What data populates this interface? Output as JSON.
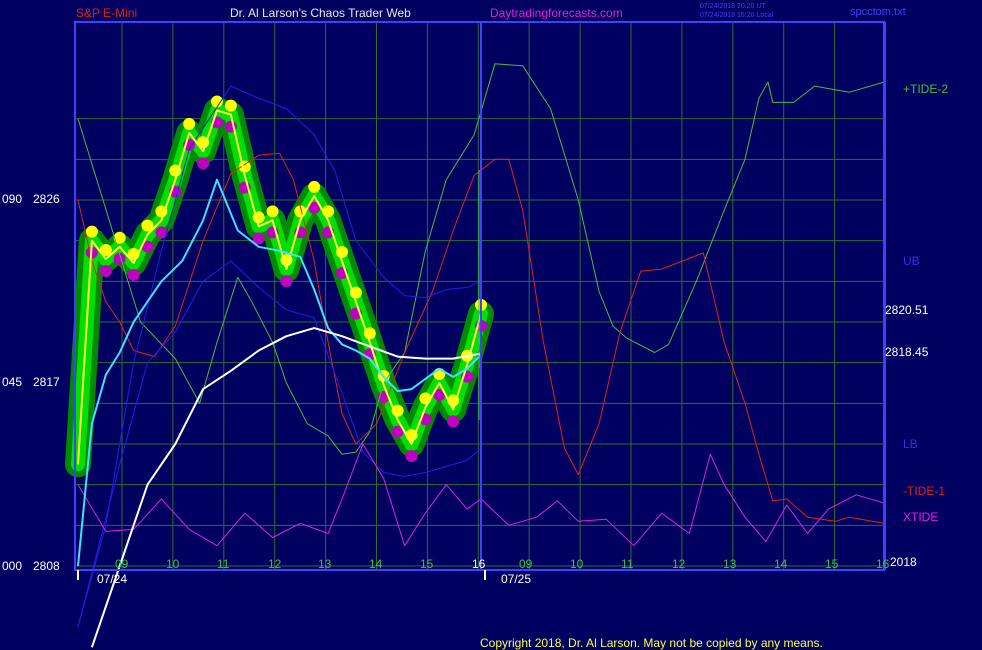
{
  "header": {
    "instrument": "S&P E-Mini",
    "site": "Dr. Al Larson's Chaos Trader Web",
    "url": "Daytradingforecasts.com",
    "stamp_ut": "07/24/2018 20:20 UT",
    "stamp_local": "07/24/2018 15:20 Local",
    "file": "spcctom.txt"
  },
  "left_axis": [
    {
      "pct": "090",
      "price": "2826"
    },
    {
      "pct": "045",
      "price": "2817"
    },
    {
      "pct": "000",
      "price": "2808"
    }
  ],
  "right_labels": {
    "tide2": "+TIDE-2",
    "ub": "UB",
    "price1": "2820.51",
    "price2": "2818.45",
    "lb": "LB",
    "tide1": "-TIDE-1",
    "xtide": "XTIDE",
    "year": "2018"
  },
  "hour_ticks": [
    "09",
    "10",
    "11",
    "12",
    "13",
    "14",
    "15",
    "16",
    "09",
    "10",
    "11",
    "12",
    "13",
    "14",
    "15",
    "16"
  ],
  "dates": [
    "07/24",
    "07/25"
  ],
  "copyright": "Copyright 2018, Dr. Al Larson. May not be copied by any means.",
  "colors": {
    "background": "#000060",
    "frame": "#4040ff",
    "grid": "#2e6e2e",
    "price": "#00e000",
    "price_band": "#008a00",
    "high_dots": "#ffff00",
    "low_dots": "#c000c0",
    "fast_avg": "#ffff40",
    "mid_avg": "#40e0ff",
    "slow_avg": "#ffffff",
    "tide_pos": "#40c040",
    "tide_neg": "#e02020",
    "bands": "#2020e0",
    "xtide": "#e020e0"
  },
  "chart_data": {
    "type": "line",
    "title": "S&P E-Mini",
    "y_ticks": [
      2808,
      2817,
      2826
    ],
    "ylim": [
      2808,
      2830
    ],
    "price_labels": [
      2820.51,
      2818.45
    ],
    "x_ticks": [
      "09",
      "10",
      "11",
      "12",
      "13",
      "14",
      "15",
      "16",
      "09",
      "10",
      "11",
      "12",
      "13",
      "14",
      "15",
      "16"
    ],
    "x_dates": [
      "07/24",
      "07/25"
    ],
    "grid": true,
    "series": [
      {
        "name": "+TIDE-2",
        "values": [
          [
            0,
            2830
          ],
          [
            9,
            2820
          ],
          [
            14,
            2818.2
          ],
          [
            17.5,
            2816
          ],
          [
            20,
            2819
          ],
          [
            23,
            2822.2
          ],
          [
            25,
            2821
          ],
          [
            28,
            2819
          ],
          [
            30,
            2817
          ],
          [
            33,
            2815
          ],
          [
            36,
            2814.4
          ],
          [
            38,
            2813.5
          ],
          [
            40,
            2813.6
          ],
          [
            42,
            2814.6
          ],
          [
            44,
            2817
          ],
          [
            47,
            2818.5
          ],
          [
            50,
            2823.5
          ],
          [
            53,
            2827
          ],
          [
            57,
            2829.2
          ],
          [
            60,
            2832.7
          ],
          [
            64,
            2832.6
          ],
          [
            68,
            2830.5
          ],
          [
            72,
            2826
          ],
          [
            75,
            2821.5
          ],
          [
            77,
            2819.8
          ],
          [
            79,
            2819.2
          ],
          [
            83,
            2818.5
          ],
          [
            85,
            2818.9
          ],
          [
            89,
            2822
          ],
          [
            93,
            2825.5
          ],
          [
            96,
            2828
          ],
          [
            98,
            2831
          ],
          [
            99.3,
            2831.8
          ],
          [
            100,
            2830.8
          ],
          [
            103,
            2830.8
          ],
          [
            106,
            2831.6
          ],
          [
            111,
            2831.3
          ],
          [
            116,
            2831.8
          ]
        ]
      },
      {
        "name": "-TIDE-1",
        "values": [
          [
            0,
            2826
          ],
          [
            2,
            2823
          ],
          [
            4,
            2821
          ],
          [
            6,
            2820
          ],
          [
            8,
            2818.6
          ],
          [
            11,
            2818.3
          ],
          [
            14,
            2819.8
          ],
          [
            18,
            2824
          ],
          [
            22,
            2827.3
          ],
          [
            26,
            2828.2
          ],
          [
            29,
            2828.3
          ],
          [
            31,
            2827
          ],
          [
            34,
            2823
          ],
          [
            36,
            2819
          ],
          [
            38,
            2815.5
          ],
          [
            40,
            2814
          ],
          [
            43,
            2815
          ],
          [
            47,
            2818.5
          ],
          [
            51,
            2821.5
          ],
          [
            54,
            2824.5
          ],
          [
            57,
            2827.2
          ],
          [
            60,
            2828
          ],
          [
            62,
            2828
          ],
          [
            64,
            2825.5
          ],
          [
            67,
            2819
          ],
          [
            70,
            2813.8
          ],
          [
            72,
            2812.5
          ],
          [
            75,
            2815
          ],
          [
            78,
            2819.5
          ],
          [
            81,
            2822.5
          ],
          [
            84,
            2822.6
          ],
          [
            87,
            2823
          ],
          [
            90,
            2823.4
          ],
          [
            93,
            2819
          ],
          [
            96,
            2816
          ],
          [
            98,
            2813.5
          ],
          [
            100,
            2811.2
          ],
          [
            102,
            2811.3
          ],
          [
            105,
            2810.4
          ],
          [
            109,
            2810.2
          ],
          [
            111,
            2810.4
          ],
          [
            116,
            2810.1
          ]
        ]
      },
      {
        "name": "UB",
        "values": [
          [
            0,
            2805
          ],
          [
            4,
            2810
          ],
          [
            8,
            2818
          ],
          [
            12,
            2823.5
          ],
          [
            16,
            2828.5
          ],
          [
            22,
            2831.6
          ],
          [
            26,
            2831
          ],
          [
            30,
            2830.5
          ],
          [
            34,
            2829.2
          ],
          [
            37,
            2827.4
          ],
          [
            40,
            2824
          ],
          [
            44,
            2822.2
          ],
          [
            47,
            2821.3
          ],
          [
            50,
            2821.2
          ],
          [
            53,
            2821.6
          ],
          [
            56,
            2821.7
          ],
          [
            58,
            2822
          ]
        ]
      },
      {
        "name": "LB",
        "values": [
          [
            0,
            2805
          ],
          [
            6,
            2813
          ],
          [
            10,
            2818
          ],
          [
            14,
            2819.5
          ],
          [
            18,
            2822
          ],
          [
            22,
            2823
          ],
          [
            26,
            2821.7
          ],
          [
            30,
            2820.6
          ],
          [
            34,
            2820.2
          ],
          [
            38,
            2816.5
          ],
          [
            41,
            2813.6
          ],
          [
            44,
            2812.6
          ],
          [
            47,
            2812.4
          ],
          [
            50,
            2812.6
          ],
          [
            53,
            2812.9
          ],
          [
            56,
            2813.2
          ],
          [
            58,
            2813.8
          ]
        ]
      },
      {
        "name": "XTIDE",
        "values": [
          [
            0,
            2812
          ],
          [
            4,
            2809.7
          ],
          [
            8,
            2809.8
          ],
          [
            12,
            2811.3
          ],
          [
            16,
            2809.8
          ],
          [
            20,
            2809
          ],
          [
            24,
            2810.6
          ],
          [
            28,
            2809.4
          ],
          [
            32,
            2810.1
          ],
          [
            36,
            2809.6
          ],
          [
            38,
            2811.3
          ],
          [
            41,
            2814
          ],
          [
            44,
            2812.3
          ],
          [
            47,
            2809
          ],
          [
            50,
            2810.6
          ],
          [
            53,
            2812
          ],
          [
            56,
            2810.8
          ],
          [
            58,
            2811.3
          ],
          [
            62,
            2810
          ],
          [
            66,
            2810.4
          ],
          [
            69,
            2811.2
          ],
          [
            72,
            2810.2
          ],
          [
            76,
            2810.3
          ],
          [
            80,
            2809
          ],
          [
            84,
            2810.6
          ],
          [
            88,
            2809.6
          ],
          [
            91,
            2813.5
          ],
          [
            93,
            2812
          ],
          [
            96,
            2810.4
          ],
          [
            99,
            2809.2
          ],
          [
            102,
            2811
          ],
          [
            105,
            2809.6
          ],
          [
            108,
            2810.8
          ],
          [
            112,
            2811.5
          ],
          [
            116,
            2811.1
          ]
        ]
      },
      {
        "name": "",
        "values": [
          [
            0,
            2813
          ],
          [
            2,
            2824
          ],
          [
            4,
            2823.1
          ],
          [
            6,
            2823.7
          ],
          [
            8,
            2822.9
          ],
          [
            10,
            2824.3
          ],
          [
            12,
            2825
          ],
          [
            14,
            2827
          ],
          [
            16,
            2829.3
          ],
          [
            18,
            2828.4
          ],
          [
            20,
            2830.4
          ],
          [
            22,
            2830.2
          ],
          [
            24,
            2827.2
          ],
          [
            26,
            2824.7
          ],
          [
            28,
            2825
          ],
          [
            30,
            2822.6
          ],
          [
            32,
            2825
          ],
          [
            34,
            2826.2
          ],
          [
            36,
            2825
          ],
          [
            38,
            2823
          ],
          [
            40,
            2821
          ],
          [
            42,
            2819
          ],
          [
            44,
            2816.9
          ],
          [
            46,
            2815.2
          ],
          [
            48,
            2814
          ],
          [
            50,
            2815.8
          ],
          [
            52,
            2817
          ],
          [
            54,
            2815.7
          ],
          [
            56,
            2817.9
          ],
          [
            58,
            2820.4
          ]
        ]
      },
      {
        "name": "",
        "values": [
          [
            0,
            2808
          ],
          [
            2,
            2815
          ],
          [
            4,
            2817.4
          ],
          [
            6,
            2818.5
          ],
          [
            8,
            2820
          ],
          [
            12,
            2822
          ],
          [
            15,
            2823
          ],
          [
            18,
            2825
          ],
          [
            20,
            2827
          ],
          [
            23,
            2824.5
          ],
          [
            26,
            2823.7
          ],
          [
            29,
            2823.5
          ],
          [
            32,
            2823.2
          ],
          [
            34,
            2821.6
          ],
          [
            36,
            2819.7
          ],
          [
            38,
            2818.9
          ],
          [
            40,
            2818.6
          ],
          [
            42,
            2818.2
          ],
          [
            44,
            2817.3
          ],
          [
            46,
            2816.6
          ],
          [
            48,
            2816.7
          ],
          [
            50,
            2817.2
          ],
          [
            52,
            2817.7
          ],
          [
            54,
            2817.3
          ],
          [
            56,
            2817.7
          ],
          [
            58,
            2818.4
          ]
        ]
      },
      {
        "name": "",
        "values": [
          [
            2,
            2804
          ],
          [
            6,
            2808
          ],
          [
            10,
            2812
          ],
          [
            14,
            2814
          ],
          [
            18,
            2816.7
          ],
          [
            22,
            2817.6
          ],
          [
            26,
            2818.6
          ],
          [
            30,
            2819.3
          ],
          [
            34,
            2819.7
          ],
          [
            38,
            2819.3
          ],
          [
            42,
            2818.8
          ],
          [
            46,
            2818.3
          ],
          [
            50,
            2818.2
          ],
          [
            54,
            2818.2
          ],
          [
            58,
            2818.45
          ]
        ]
      }
    ]
  }
}
